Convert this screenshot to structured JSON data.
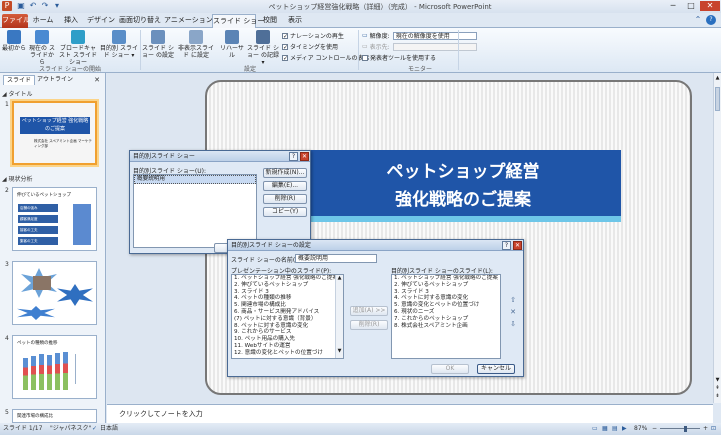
{
  "window": {
    "title": "ペットショップ経営強化戦略（詳細）（完成） - Microsoft PowerPoint",
    "minimize": "─",
    "maximize": "□",
    "close": "✕"
  },
  "tabs": [
    {
      "label": "ファイル"
    },
    {
      "label": "ホーム"
    },
    {
      "label": "挿入"
    },
    {
      "label": "デザイン"
    },
    {
      "label": "画面切り替え"
    },
    {
      "label": "アニメーション"
    },
    {
      "label": "スライド ショー"
    },
    {
      "label": "校閲"
    },
    {
      "label": "表示"
    }
  ],
  "ribbon": {
    "buttons": [
      {
        "label": "最初から"
      },
      {
        "label": "現在の スライドから"
      },
      {
        "label": "ブロードキャスト スライド ショー"
      },
      {
        "label": "目的別 スライド ショー ▾"
      },
      {
        "label": "スライド ショー の設定"
      },
      {
        "label": "非表示スライド に設定"
      },
      {
        "label": "リハーサル"
      },
      {
        "label": "スライド ショー の記録 ▾"
      }
    ],
    "checkboxes": [
      "ナレーションの再生",
      "タイミングを使用",
      "メディア コントロールの表示"
    ],
    "resolution_label": "解像度:",
    "resolution_value": "現在の解像度を使用",
    "display_label": "表示先:",
    "presenter_label": "発表者ツールを使用する",
    "groups": [
      "スライド ショーの開始",
      "設定",
      "モニター"
    ]
  },
  "left_panel": {
    "tabs": [
      "スライド",
      "アウトライン"
    ],
    "sections": [
      "タイトル",
      "現状分析"
    ],
    "slides": [
      {
        "num": "1",
        "title": "ペットショップ経営 強化戦略のご提案",
        "sub": "株式会社 スペアミント企画 マーケティング部"
      },
      {
        "num": "2",
        "title": "伸びているペットショップ",
        "boxes": [
          "店舗の強み",
          "顧客満足度",
          "接客の工夫",
          "集客の工夫"
        ]
      },
      {
        "num": "3",
        "title": "ペットショップの生き残り",
        "sub": ""
      },
      {
        "num": "4",
        "title": "ペットの種類の推移"
      },
      {
        "num": "5",
        "title": "関連市場の構成比"
      }
    ]
  },
  "slide": {
    "title_line1": "ペットショップ経営",
    "title_line2": "強化戦略のご提案"
  },
  "notes_placeholder": "クリックしてノートを入力",
  "status": {
    "slide_info": "スライド 1/17",
    "theme": "\"ジャパネスク\"",
    "language": "日本語",
    "zoom": "87%"
  },
  "dialog_custom": {
    "title": "目的別スライド ショー",
    "help": "?",
    "close": "✕",
    "list_label": "目的別スライド ショー(U):",
    "items": [
      "概要説明用"
    ],
    "buttons": [
      "新規作成(N)...",
      "編集(E)...",
      "削除(R)",
      "コピー(Y)"
    ]
  },
  "dialog_define": {
    "title": "目的別スライド ショーの設定",
    "help": "?",
    "close": "✕",
    "name_label": "スライド ショーの名前(N):",
    "name_value": "概要説明用",
    "left_label": "プレゼンテーション中のスライド(P):",
    "left_items": [
      "1. ペットショップ経営 強化戦略のご提案",
      "2. 伸びているペットショップ",
      "3. スライド 3",
      "4. ペットの種類の推移",
      "5. 関連市場の構成比",
      "6. 商品・サービス開発アドバイス",
      "(7) ペットに対する意識（背景）",
      "8. ペットに対する意識の変化",
      "9. これからのサービス",
      "10. ペット用品の購入先",
      "11. Webサイトの運営",
      "12. 意識の変化とペットの位置づけ"
    ],
    "add_btn": "追加(A) >>",
    "remove_btn": "削除(R)",
    "right_label": "目的別スライド ショーのスライド(L):",
    "right_items": [
      "1. ペットショップ経営 強化戦略のご提案",
      "2. 伸びているペットショップ",
      "3. スライド 3",
      "4. ペットに対する意識の変化",
      "5. 意識の変化とペットの位置づけ",
      "6. 現状のニーズ",
      "7. これからのペットショップ",
      "8. 株式会社スペアミント企画"
    ],
    "ok": "OK",
    "cancel": "キャンセル"
  }
}
